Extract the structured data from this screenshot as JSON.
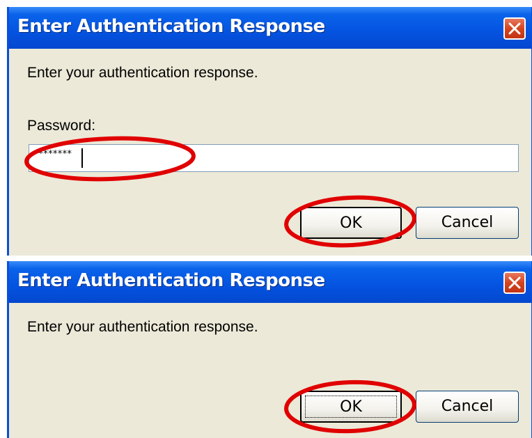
{
  "dialogs": [
    {
      "title": "Enter Authentication Response",
      "message": "Enter your authentication response.",
      "password_label": "Password:",
      "password_value": "********",
      "ok_label": "OK",
      "cancel_label": "Cancel"
    },
    {
      "title": "Enter Authentication Response",
      "message": "Enter your authentication response.",
      "ok_label": "OK",
      "cancel_label": "Cancel"
    }
  ],
  "colors": {
    "titlebar": "#0453e0",
    "dialog_background": "#ece9d8",
    "annotation": "#e00000",
    "close_button": "#d4441f"
  }
}
